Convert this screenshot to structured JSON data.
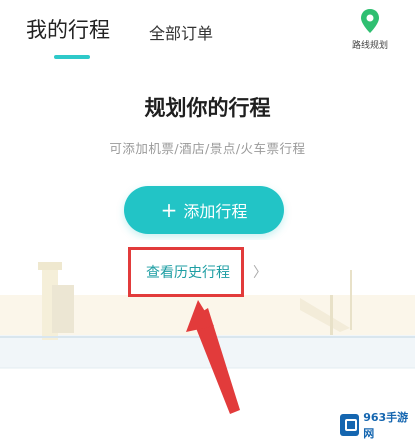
{
  "tabs": {
    "active_label": "我的行程",
    "other_label": "全部订单"
  },
  "map_button": {
    "label": "路线规划",
    "icon": "map-pin-icon"
  },
  "main": {
    "title": "规划你的行程",
    "subtitle": "可添加机票/酒店/景点/火车票行程",
    "add_button_label": "添加行程",
    "history_link_label": "查看历史行程",
    "history_chevron": "〉"
  },
  "colors": {
    "accent": "#22c4c6",
    "annotation_red": "#e23b3b",
    "link": "#1d9ea3"
  },
  "watermark": {
    "text": "963手游网"
  }
}
